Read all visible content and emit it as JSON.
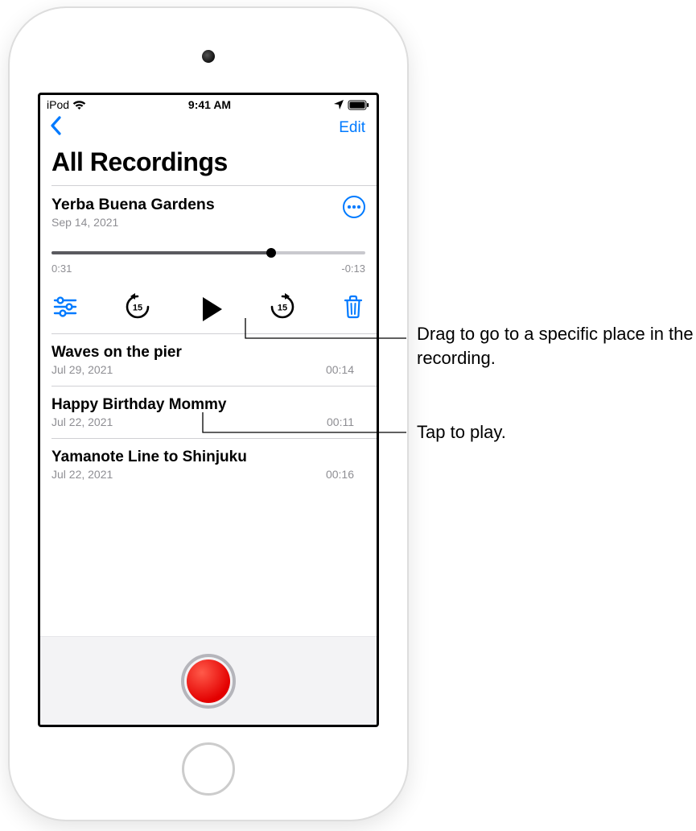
{
  "statusBar": {
    "carrier": "iPod",
    "time": "9:41 AM"
  },
  "nav": {
    "edit": "Edit"
  },
  "title": "All Recordings",
  "expanded": {
    "title": "Yerba Buena Gardens",
    "date": "Sep 14, 2021",
    "elapsed": "0:31",
    "remaining": "-0:13",
    "scrubber_percent": 70
  },
  "recordings": [
    {
      "title": "Waves on the pier",
      "date": "Jul 29, 2021",
      "duration": "00:14"
    },
    {
      "title": "Happy Birthday Mommy",
      "date": "Jul 22, 2021",
      "duration": "00:11"
    },
    {
      "title": "Yamanote Line to Shinjuku",
      "date": "Jul 22, 2021",
      "duration": "00:16"
    }
  ],
  "callouts": {
    "scrubber": "Drag to go to a specific place in the recording.",
    "play": "Tap to play."
  }
}
